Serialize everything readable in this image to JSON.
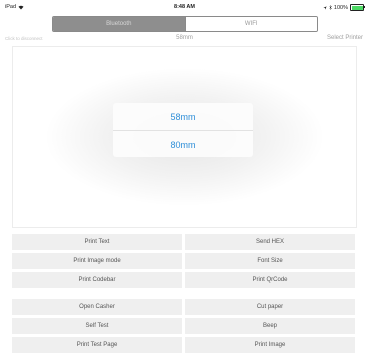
{
  "status_bar": {
    "device": "iPad",
    "time": "8:48 AM",
    "battery": "100%",
    "battery_level": 1.0,
    "icons": [
      "wifi-icon",
      "location-icon",
      "bluetooth-icon",
      "battery-icon"
    ]
  },
  "connection_tabs": [
    {
      "label": "Bluetooth",
      "active": true
    },
    {
      "label": "WIFI",
      "active": false
    }
  ],
  "subheader": {
    "left": "Click to disconnect",
    "paper_size": "58mm",
    "right": "Select Printer"
  },
  "paper_picker": {
    "options": [
      "58mm",
      "80mm"
    ]
  },
  "buttons_group1": [
    "Print Text",
    "Send HEX",
    "Print Image mode",
    "Font Size",
    "Print Codebar",
    "Print QrCode"
  ],
  "buttons_group2": [
    "Open Casher",
    "Cut paper",
    "Self Test",
    "Beep",
    "Print Test Page",
    "Print Image"
  ],
  "colors": {
    "accent": "#2f8fd8",
    "battery": "#4cd964",
    "segment_active": "#8e8e8e",
    "button_bg": "#efefef"
  }
}
